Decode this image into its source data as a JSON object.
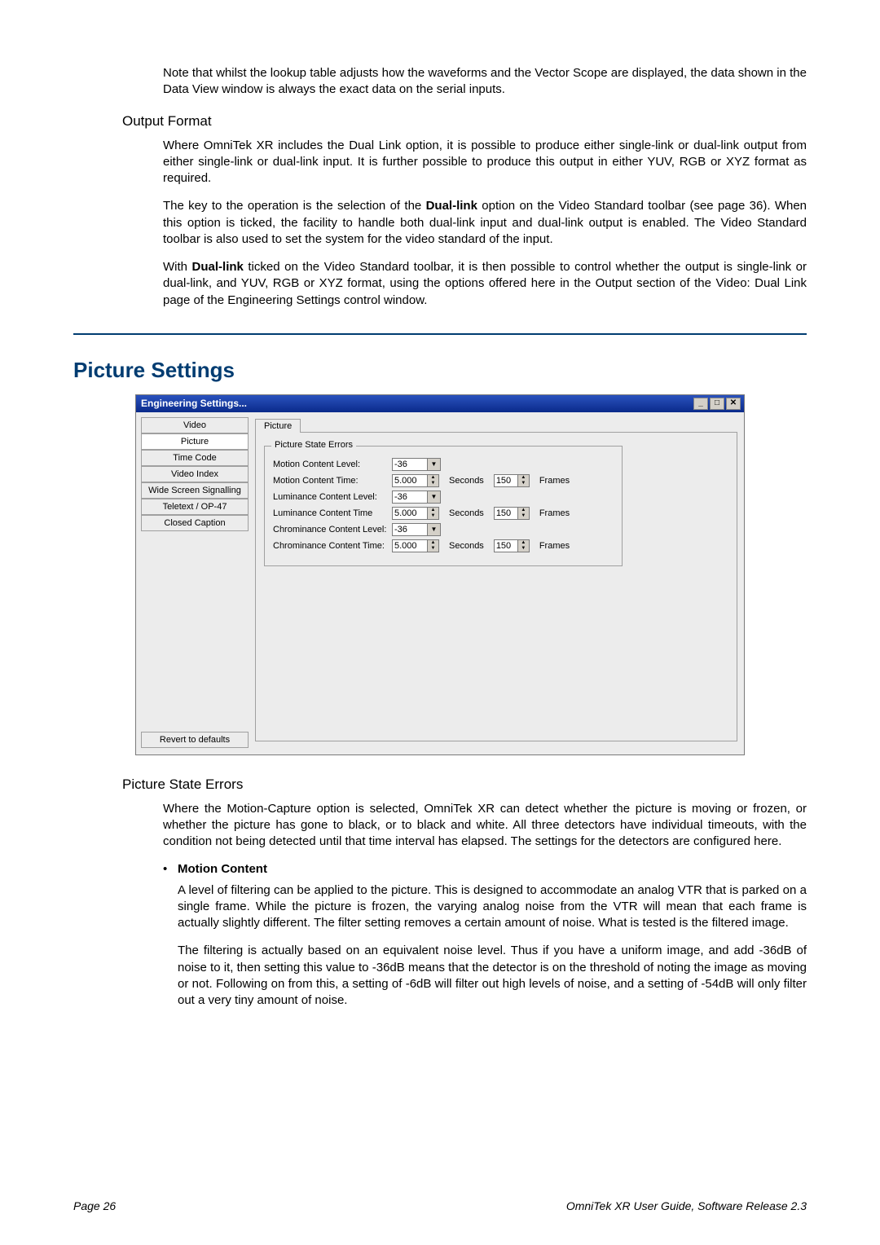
{
  "intro_para": "Note that whilst the lookup table adjusts how the waveforms and the Vector Scope are displayed, the data shown in the Data View window is always the exact data on the serial inputs.",
  "output_format": {
    "heading": "Output Format",
    "p1": "Where OmniTek XR includes the Dual Link option, it is possible to produce either single-link or dual-link output from either single-link or dual-link input. It is further possible to produce this output in either YUV, RGB or XYZ format as required.",
    "p2_a": "The key to the operation is the selection of the ",
    "p2_bold": "Dual-link",
    "p2_b": " option on the Video Standard toolbar (see page 36). When this option is ticked, the facility to handle both dual-link input and dual-link output is enabled. The Video Standard toolbar is also used to set the system for the video standard of the input.",
    "p3_a": "With ",
    "p3_bold": "Dual-link",
    "p3_b": " ticked on the Video Standard toolbar, it is then possible to control whether the output is single-link or dual-link, and YUV, RGB or XYZ format, using the options offered here in the Output section of the Video: Dual Link page of the Engineering Settings control window."
  },
  "picture_settings_heading": "Picture Settings",
  "window": {
    "title": "Engineering Settings...",
    "sidebar": [
      "Video",
      "Picture",
      "Time Code",
      "Video Index",
      "Wide Screen Signalling",
      "Teletext / OP-47",
      "Closed Caption"
    ],
    "selected_index": 1,
    "revert": "Revert to defaults",
    "tab": "Picture",
    "group": "Picture State Errors",
    "rows": {
      "motion_level": {
        "label": "Motion Content Level:",
        "value": "-36"
      },
      "motion_time": {
        "label": "Motion Content Time:",
        "sec": "5.000",
        "sec_unit": "Seconds",
        "frames": "150",
        "frames_unit": "Frames"
      },
      "lum_level": {
        "label": "Luminance Content Level:",
        "value": "-36"
      },
      "lum_time": {
        "label": "Luminance Content Time",
        "sec": "5.000",
        "sec_unit": "Seconds",
        "frames": "150",
        "frames_unit": "Frames"
      },
      "chrom_level": {
        "label": "Chrominance Content Level:",
        "value": "-36"
      },
      "chrom_time": {
        "label": "Chrominance Content Time:",
        "sec": "5.000",
        "sec_unit": "Seconds",
        "frames": "150",
        "frames_unit": "Frames"
      }
    }
  },
  "picture_state_errors": {
    "heading": "Picture State Errors",
    "p1": "Where the Motion-Capture option is selected, OmniTek XR can detect whether the picture is moving or frozen, or whether the picture has gone to black, or to black and white. All three detectors have individual timeouts, with the condition not being detected until that time interval has elapsed. The settings for the detectors are configured here.",
    "bullet": "Motion Content",
    "p2": "A level of filtering can be applied to the picture. This is designed to accommodate an analog VTR that is parked on a single frame. While the picture is frozen, the varying analog noise from the VTR will mean that each frame is actually slightly different. The filter setting removes a certain amount of noise. What is tested is the filtered image.",
    "p3": "The filtering is actually based on an equivalent noise level. Thus if you have a uniform image, and add -36dB of noise to it, then setting this value to -36dB means that the detector is on the threshold of noting the image as moving or not. Following on from this, a setting of -6dB will filter out high levels of noise, and a setting of -54dB will only filter out a very tiny amount of noise."
  },
  "footer": {
    "left": "Page 26",
    "right": "OmniTek XR User Guide, Software Release 2.3"
  }
}
